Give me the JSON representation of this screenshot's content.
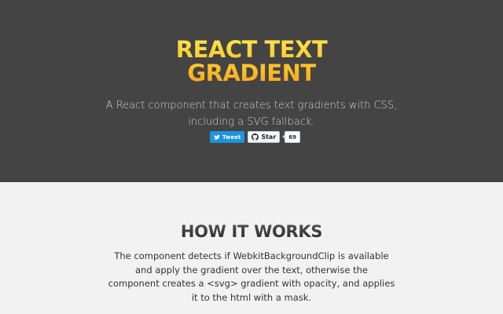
{
  "hero": {
    "title_lines": [
      "REACT TEXT",
      "GRADIENT"
    ],
    "subtitle_lines": [
      "A React component that creates text gradients with CSS,",
      "including a SVG fallback."
    ],
    "background": "#444444",
    "gradient_colors": [
      "#ffe44d",
      "#ffc72a",
      "#f5a623"
    ]
  },
  "social": {
    "tweet_label": "Tweet",
    "tweet_icon": "twitter-bird-icon",
    "star_label": "Star",
    "star_icon": "github-mark-icon",
    "star_count": "69",
    "tweet_color": "#1b95e0"
  },
  "section": {
    "title": "HOW IT WORKS",
    "body_lines": [
      "The component detects if WebkitBackgroundClip is available",
      "and apply the gradient over the text, otherwise the",
      "component creates a <svg> gradient with opacity, and applies",
      "it to the html with a mask."
    ],
    "background": "#f2f2f2"
  }
}
